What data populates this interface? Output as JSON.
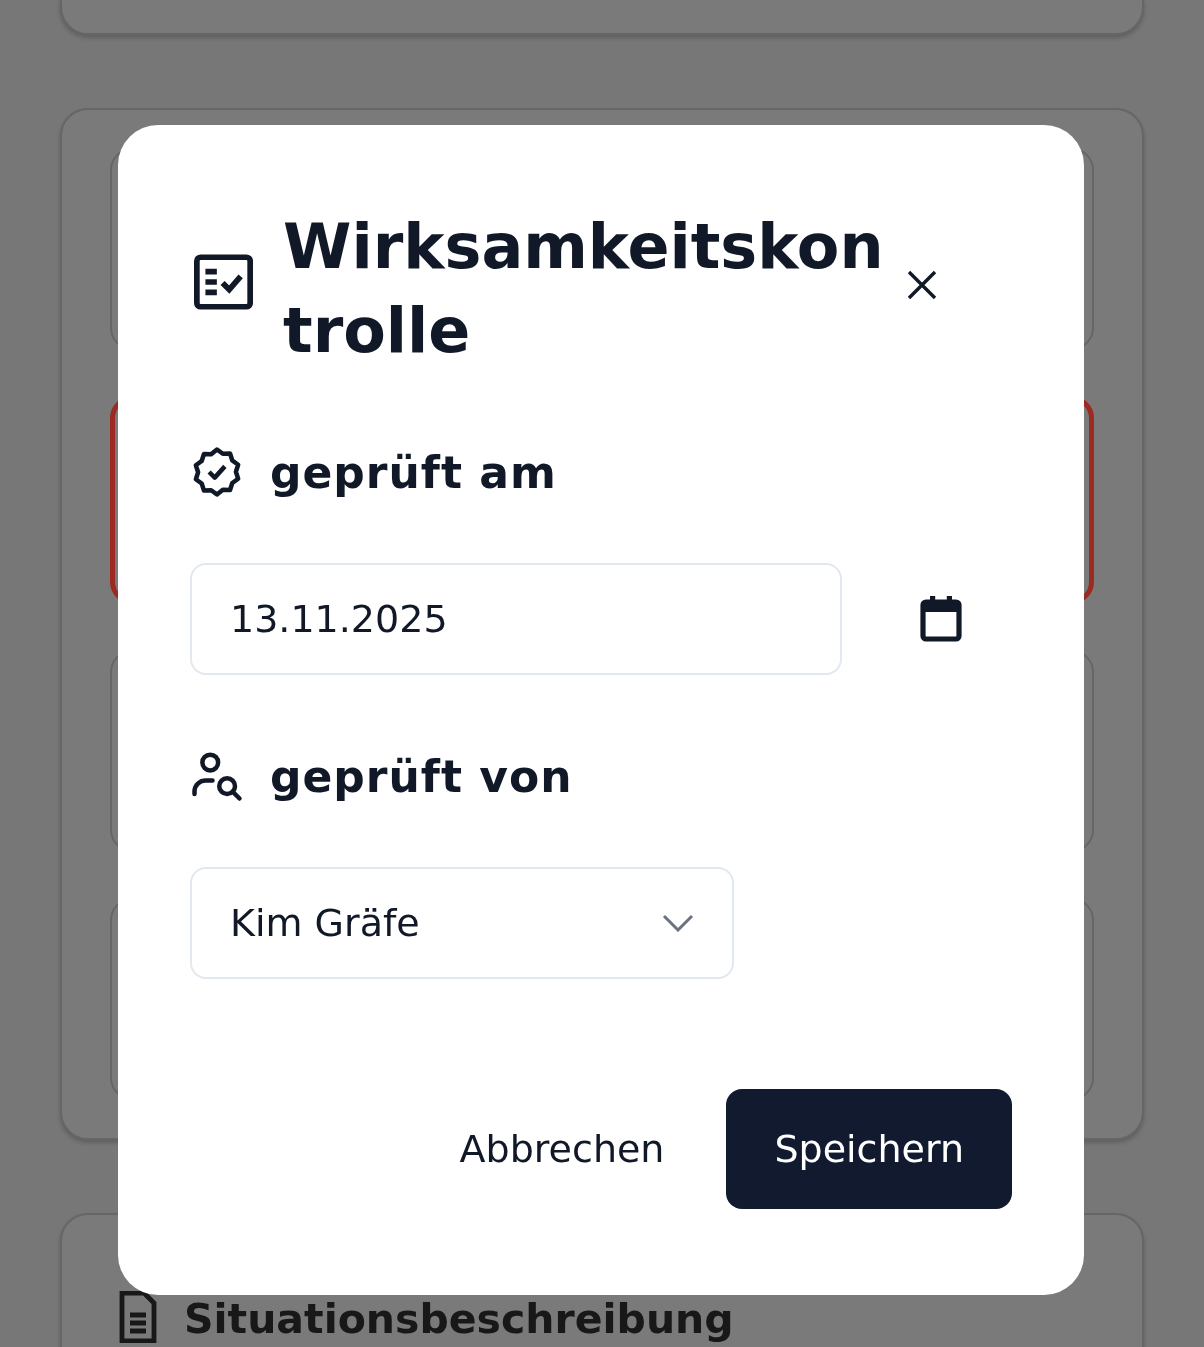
{
  "background": {
    "cards": [
      {
        "invalid": false
      },
      {
        "invalid": true
      },
      {
        "invalid": false
      },
      {
        "invalid": false
      }
    ],
    "section_title": "Situationsbeschreibung"
  },
  "dialog": {
    "title": "Wirksamkeitskontrolle",
    "fields": [
      {
        "kind": "date",
        "label": "geprüft am",
        "value": "13.11.2025"
      },
      {
        "kind": "select",
        "label": "geprüft von",
        "value": "Kim Gräfe"
      }
    ],
    "buttons": [
      {
        "label": "Abbrechen",
        "primary": false
      },
      {
        "label": "Speichern",
        "primary": true
      }
    ]
  }
}
